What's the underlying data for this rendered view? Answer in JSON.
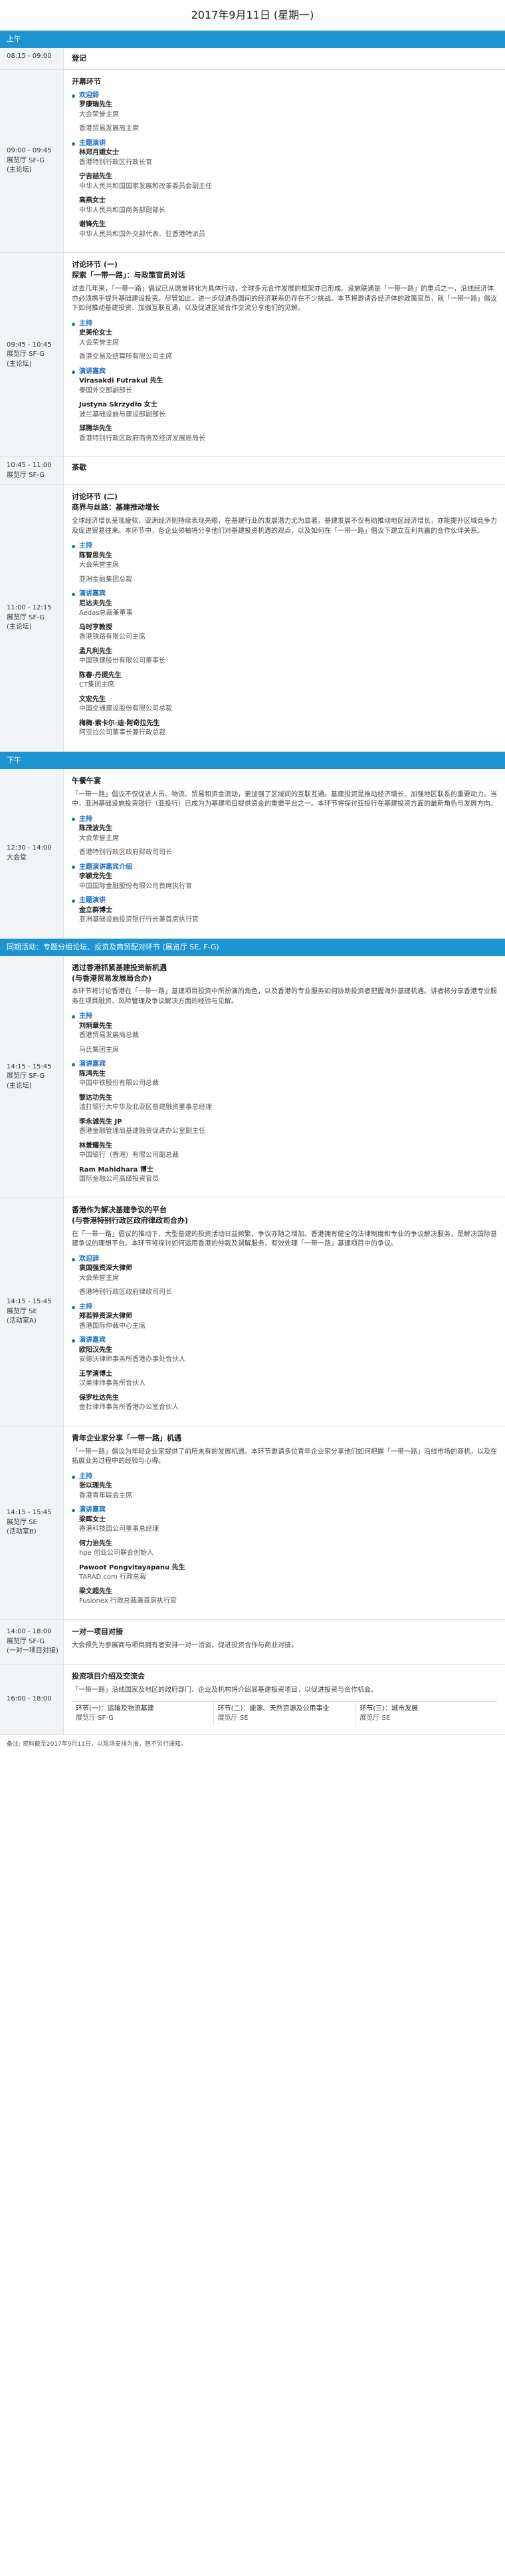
{
  "page": {
    "title": "2017年9月11日 (星期一)"
  },
  "am_label": "上午",
  "pm_label": "下午",
  "sessions": [
    {
      "time": "08:15 - 09:00",
      "venue": [],
      "title": "登记",
      "subtitle": "",
      "desc": "",
      "groups": []
    },
    {
      "time": "09:00 - 09:45",
      "venue": [
        "展览厅 SF-G",
        "(主论坛)"
      ],
      "title": "开幕环节",
      "subtitle": "",
      "desc": "",
      "groups": [
        {
          "role": "欢迎辞",
          "people": [
            {
              "name": "罗康瑞先生",
              "title": "大会荣誉主席"
            },
            {
              "name": "",
              "title": "香港贸易发展局主席"
            }
          ]
        },
        {
          "role": "主题演讲",
          "people": [
            {
              "name": "林郑月娥女士",
              "title": "香港特别行政区行政长官"
            },
            {
              "name": "宁吉喆先生",
              "title": "中华人民共和国国家发展和改革委员会副主任"
            },
            {
              "name": "高燕女士",
              "title": "中华人民共和国商务部副部长"
            },
            {
              "name": "谢锋先生",
              "title": "中华人民共和国外交部代表、驻香港特派员"
            }
          ]
        }
      ]
    },
    {
      "time": "09:45 - 10:45",
      "venue": [
        "展览厅 SF-G",
        "(主论坛)"
      ],
      "title": "讨论环节 (一)",
      "subtitle": "探索「一带一路」：与政策官员对话",
      "desc": "过去几年来，「一带一路」倡议已从愿景转化为具体行动，全球多元合作发展的框架亦已形成。设施联通是「一带一路」的重点之一，沿线经济体亦必须携手提升基础建设投资。尽管如此，进一步促进各国间的经济联系仍存在不少挑战。本节将邀请各经济体的政策官员，就「一带一路」倡议下如何推动基建投资、加强互联互通，以及促进区域合作交流分享他们的见解。",
      "groups": [
        {
          "role": "主持",
          "people": [
            {
              "name": "史美伦女士",
              "title": "大会荣誉主席"
            },
            {
              "name": "",
              "title": "香港交易及结算所有限公司主席"
            }
          ]
        },
        {
          "role": "演讲嘉宾",
          "people": [
            {
              "name": "Virasakdi Futrakul 先生",
              "title": "泰国外交部副部长"
            },
            {
              "name": "Justyna Skrzydło 女士",
              "title": "波兰基础设施与建设部副部长"
            },
            {
              "name": "邱腾华先生",
              "title": "香港特别行政区政府商务及经济发展局局长"
            }
          ]
        }
      ]
    },
    {
      "time": "10:45 - 11:00",
      "venue": [
        "展览厅 SF-G"
      ],
      "title": "茶歇",
      "subtitle": "",
      "desc": "",
      "groups": []
    },
    {
      "time": "11:00 - 12:15",
      "venue": [
        "展览厅 SF-G",
        "(主论坛)"
      ],
      "title": "讨论环节 (二)",
      "subtitle": "商界与丝路：基建推动增长",
      "desc": "全球经济增长呈现疲软，亚洲经济则持续表现亮眼，在基建行业的发展潜力尤为显著。基建发展不仅有助推动地区经济增长，亦能提升区域竞争力及促进贸易往来。本环节中，各企业领袖将分享他们对基建投资机遇的观点，以及如何在「一带一路」倡议下建立互利共赢的合作伙伴关系。",
      "groups": [
        {
          "role": "主持",
          "people": [
            {
              "name": "陈智思先生",
              "title": "大会荣誉主席"
            },
            {
              "name": "",
              "title": "亚洲金融集团总裁"
            }
          ]
        },
        {
          "role": "演讲嘉宾",
          "people": [
            {
              "name": "尼达夫先生",
              "title": "Aedas总裁兼董事"
            },
            {
              "name": "马时亨教授",
              "title": "香港铁路有限公司主席"
            },
            {
              "name": "孟凡利先生",
              "title": "中国铁建股份有限公司董事长"
            },
            {
              "name": "陈春·丹提先生",
              "title": "CT集团主席"
            },
            {
              "name": "文宏先生",
              "title": "中国交通建设股份有限公司总裁"
            },
            {
              "name": "梅梅·索卡尔·迪·阿奇拉先生",
              "title": "阿亚拉公司董事长兼行政总裁"
            }
          ]
        }
      ]
    },
    {
      "time": "12:30 - 14:00",
      "venue": [
        "大会堂"
      ],
      "title": "午餐午宴",
      "subtitle": "",
      "desc": "「一带一路」倡议不仅促进人员、物流、贸易和资金流动，更加强了区域间的互联互通。基建投资是推动经济增长、加强地区联系的重要动力。当中，亚洲基础设施投资银行（亚投行）已成为为基建项目提供资金的重要平台之一。本环节将探讨亚投行在基建投资方面的最新角色与发展方向。",
      "groups": [
        {
          "role": "主持",
          "people": [
            {
              "name": "陈茂波先生",
              "title": "大会荣誉主席"
            },
            {
              "name": "",
              "title": "香港特别行政区政府财政司司长"
            }
          ]
        },
        {
          "role": "主题演讲嘉宾介绍",
          "people": [
            {
              "name": "李颖龙先生",
              "title": "中国国际金融股份有限公司首席执行官"
            }
          ]
        },
        {
          "role": "主题演讲",
          "people": [
            {
              "name": "金立群博士",
              "title": "亚洲基础设施投资银行行长兼首席执行官"
            }
          ]
        }
      ]
    },
    {
      "banner": "同期活动：专题分组论坛、投资及商贸配对环节 (展览厅 SE, F-G)"
    },
    {
      "time": "14:15 - 15:45",
      "venue": [
        "展览厅 SF-G",
        "(主论坛)"
      ],
      "title": "透过香港抓紧基建投资新机遇",
      "subtitle": "(与香港贸易发展局合办)",
      "desc": "本环节将讨论香港在「一带一路」基建项目投资中所扮演的角色，以及香港的专业服务如何协助投资者把握海外基建机遇。讲者将分享香港专业服务在项目融资、风险管理及争议解决方面的经验与见解。",
      "groups": [
        {
          "role": "主持",
          "people": [
            {
              "name": "刘炳章先生",
              "title": "香港贸易发展局总裁"
            },
            {
              "name": "",
              "title": "马氏集团主席"
            }
          ]
        },
        {
          "role": "演讲嘉宾",
          "people": [
            {
              "name": "陈鸿先生",
              "title": "中国中铁股份有限公司总裁"
            },
            {
              "name": "黎达功先生",
              "title": "渣打银行大中华及北亚区基建融资董事总经理"
            },
            {
              "name": "李永诚先生 JP",
              "title": "香港金融管理局基建融资促进办公室副主任"
            },
            {
              "name": "林景耀先生",
              "title": "中国银行（香港）有限公司副总裁"
            },
            {
              "name": "Ram Mahidhara 博士",
              "title": "国际金融公司高级投资官员"
            }
          ]
        }
      ]
    },
    {
      "time": "14:15 - 15:45",
      "venue": [
        "展览厅 SE",
        "(活动室A)"
      ],
      "title": "香港作为解决基建争议的平台",
      "subtitle": "(与香港特别行政区政府律政司合办)",
      "desc": "在「一带一路」倡议的推动下，大型基建的投资活动日益频繁，争议亦随之增加。香港拥有健全的法律制度和专业的争议解决服务，是解决国际基建争议的理想平台。本环节将探讨如何运用香港的仲裁及调解服务，有效处理「一带一路」基建项目中的争议。",
      "groups": [
        {
          "role": "欢迎辞",
          "people": [
            {
              "name": "袁国强资深大律师",
              "title": "大会荣誉主席"
            },
            {
              "name": "",
              "title": "香港特别行政区政府律政司司长"
            }
          ]
        },
        {
          "role": "主持",
          "people": [
            {
              "name": "郑若骅资深大律师",
              "title": "香港国际仲裁中心主席"
            }
          ]
        },
        {
          "role": "演讲嘉宾",
          "people": [
            {
              "name": "欧阳汉先生",
              "title": "安德沃律师事务所香港办事处合伙人"
            },
            {
              "name": "王学清博士",
              "title": "汉莱律师事务所合伙人"
            },
            {
              "name": "保罗杜达先生",
              "title": "金杜律师事务所香港办公室合伙人"
            }
          ]
        }
      ]
    },
    {
      "time": "14:15 - 15:45",
      "venue": [
        "展览厅 SE",
        "(活动室B)"
      ],
      "title": "青年企业家分享「一带一路」机遇",
      "subtitle": "",
      "desc": "「一带一路」倡议为年轻企业家提供了前所未有的发展机遇。本环节邀请多位青年企业家分享他们如何把握「一带一路」沿线市场的商机，以及在拓展业务过程中的经验与心得。",
      "groups": [
        {
          "role": "主持",
          "people": [
            {
              "name": "张以理先生",
              "title": "香港青年联会主席"
            }
          ]
        },
        {
          "role": "演讲嘉宾",
          "people": [
            {
              "name": "梁晖女士",
              "title": "香港科技园公司董事总经理"
            },
            {
              "name": "何力治先生",
              "title": "hpe 创业公司联合创始人"
            },
            {
              "name": "Pawoot Pongvitayapanu 先生",
              "title": "TARAD.com 行政总裁"
            },
            {
              "name": "梁文超先生",
              "title": "Fusionex 行政总裁兼首席执行官"
            }
          ]
        }
      ]
    },
    {
      "time": "14:00 - 18:00",
      "venue": [
        "展览厅 SF-G",
        "(一对一项目对接)"
      ],
      "title": "一对一项目对接",
      "subtitle": "",
      "desc": "大会预先为参展商与项目拥有者安排一对一洽谈，促进投资合作与商业对接。",
      "groups": []
    },
    {
      "time": "16:00 - 18:00",
      "venue": [],
      "title": "投资项目介绍及交流会",
      "subtitle": "",
      "desc": "「一带一路」沿线国家及地区的政府部门、企业及机构将介绍其基建投资项目，以促进投资与合作机会。",
      "tracks": [
        {
          "name": "环节(一)：运输及物流基建",
          "venue": "展览厅 SF-G"
        },
        {
          "name": "环节(二)：能源、天然资源及公用事业",
          "venue": "展览厅 SE"
        },
        {
          "name": "环节(三)：城市发展",
          "venue": "展览厅 SE"
        }
      ]
    }
  ],
  "footnote": "备注: 资料截至2017年9月11日，以现场安排为准，恕不另行通知。"
}
